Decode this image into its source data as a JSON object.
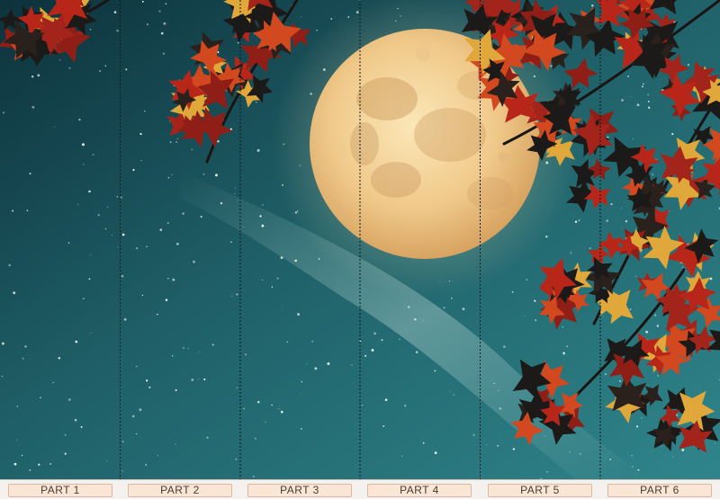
{
  "parts": {
    "labels": [
      "PART 1",
      "PART 2",
      "PART 3",
      "PART 4",
      "PART 5",
      "PART 6"
    ]
  },
  "colors": {
    "sky_top": "#0f3a44",
    "sky_bottom": "#2d7f86",
    "moon": "#f2cf8e",
    "leaf_red": "#b8261a",
    "leaf_dark": "#1c1a18",
    "label_bg": "#fbe6d6"
  },
  "icons": {
    "moon": "full-moon",
    "leaves": "autumn-leaves"
  }
}
